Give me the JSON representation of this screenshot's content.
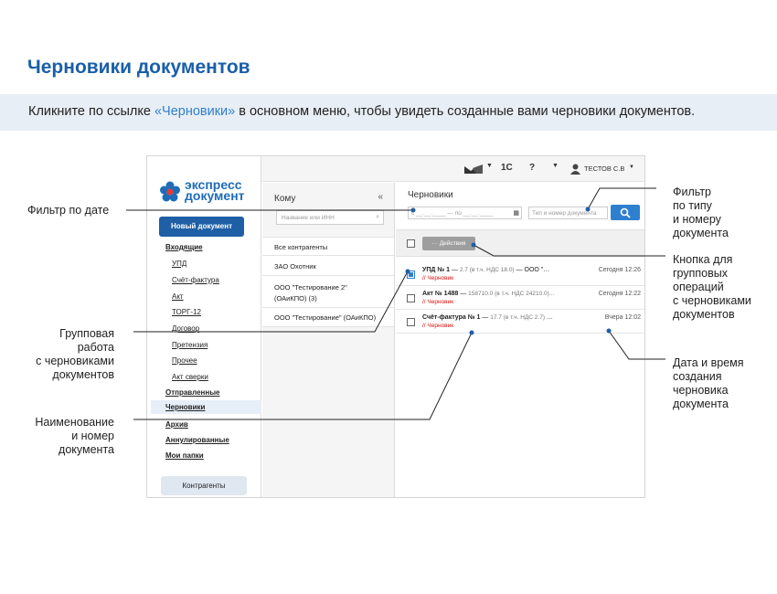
{
  "heading": "Черновики документов",
  "hint": {
    "before": "Кликните по ссылке ",
    "link": "«Черновики»",
    "after": " в основном меню, чтобы увидеть созданные вами черновики документов."
  },
  "topbar": {
    "onec": "1С",
    "help": "?",
    "user": "ТЕСТОВ С.В"
  },
  "sidebar": {
    "logo_line1": "экспресс",
    "logo_line2": "документ",
    "new_doc": "Новый документ",
    "items": [
      {
        "label": "Входящие"
      },
      {
        "label": "УПД"
      },
      {
        "label": "Счёт-фактура"
      },
      {
        "label": "Акт"
      },
      {
        "label": "ТОРГ-12"
      },
      {
        "label": "Договор"
      },
      {
        "label": "Претензия"
      },
      {
        "label": "Прочее"
      },
      {
        "label": "Акт сверки"
      },
      {
        "label": "Отправленные"
      },
      {
        "label": "Черновики"
      },
      {
        "label": "Архив"
      },
      {
        "label": "Аннулированные"
      },
      {
        "label": "Мои папки"
      }
    ],
    "contractors": "Контрагенты"
  },
  "recipients": {
    "title": "Кому",
    "collapse": "«",
    "search_placeholder": "Название или ИНН",
    "rows": [
      {
        "line1": "Все контрагенты",
        "line2": ""
      },
      {
        "line1": "ЗАО Охотник",
        "line2": ""
      },
      {
        "line1": "ООО \"Тестирование 2\"",
        "line2": "(ОАиКПО) (3)"
      },
      {
        "line1": "ООО \"Тестирование\" (ОАиКПО)",
        "line2": ""
      }
    ]
  },
  "drafts": {
    "title": "Черновики",
    "date_filter": "с __.__.____ — по __.__.____",
    "type_placeholder": "Тип и номер документа",
    "actions": "Действия",
    "rows": [
      {
        "name": "УПД № 1",
        "sep": " — ",
        "sum": "2.7 (в т.ч. НДС 18.0)",
        "org": " — ООО \"…",
        "status": "// Черновик",
        "date": "Сегодня 12:26"
      },
      {
        "name": "Акт № 1488",
        "sep": " — ",
        "sum": "158710.0 (в т.ч. НДС 24210.0)...",
        "org": "",
        "status": "// Черновик",
        "date": "Сегодня 12:22"
      },
      {
        "name": "Счёт-фактура № 1",
        "sep": " — ",
        "sum": "17.7 (в т.ч. НДС 2.7)",
        "org": " …",
        "status": "// Черновик",
        "date": "Вчера 12:02"
      }
    ]
  },
  "annotations": {
    "date_filter": "Фильтр по дате",
    "group_work": [
      "Групповая",
      "работа",
      "с черновиками",
      "документов"
    ],
    "name_number": [
      "Наименование",
      "и номер",
      "документа"
    ],
    "type_filter": [
      "Фильтр",
      "по типу",
      "и номеру",
      "документа"
    ],
    "group_button": [
      "Кнопка для",
      "групповых",
      "операций",
      "с черновиками",
      "документов"
    ],
    "created": [
      "Дата и время",
      "создания",
      "черновика",
      "документа"
    ]
  },
  "colors": {
    "brand": "#1a5fa8",
    "accent": "#2f7fd0",
    "draft": "#dd1111",
    "hint_bg": "#e7eef5"
  }
}
